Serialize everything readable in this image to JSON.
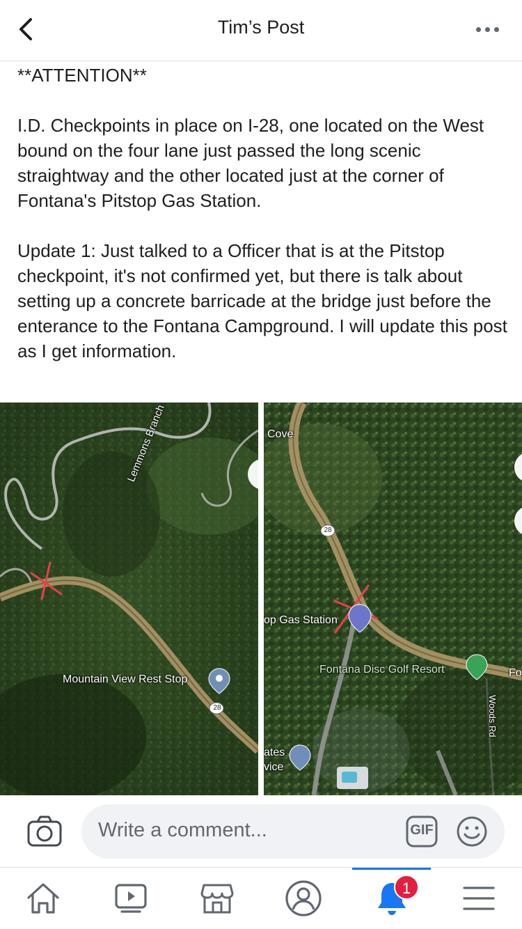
{
  "header": {
    "title": "Tim’s Post"
  },
  "post": {
    "attention": "**ATTENTION**",
    "paragraph1": "I.D. Checkpoints in place on I-28, one located on the West bound on the four lane just passed the long scenic straightway and the other located just at the corner of Fontana's Pitstop Gas Station.",
    "paragraph2": "Update 1: Just talked to a Officer that is at the Pitstop checkpoint, it's not confirmed yet, but there is talk about setting up a concrete barricade at the bridge just before the enterance to the Fontana Campground. I will update this post as I get information."
  },
  "map_left": {
    "creek_label": "Lemmons Branch",
    "poi_label": "Mountain View Rest Stop",
    "route_shield": "28"
  },
  "map_right": {
    "area_label": "Cove",
    "route_shield": "28",
    "gas_label": "op Gas Station",
    "golf_label": "Fontana Disc Golf Resort",
    "edge_label": "Fo",
    "road_label": "Woods Rd",
    "post_label_1": "ates",
    "post_label_2": "vice"
  },
  "comment": {
    "placeholder": "Write a comment...",
    "gif_label": "GIF"
  },
  "tabbar": {
    "notifications_count": "1",
    "active_tab": "notifications",
    "accent_color": "#1877f2",
    "badge_color": "#e41e3f"
  },
  "icons": [
    "back-arrow-icon",
    "more-dots-icon",
    "camera-icon",
    "gif-icon",
    "emoji-icon",
    "home-icon",
    "watch-icon",
    "marketplace-icon",
    "profile-icon",
    "bell-icon",
    "menu-icon"
  ]
}
